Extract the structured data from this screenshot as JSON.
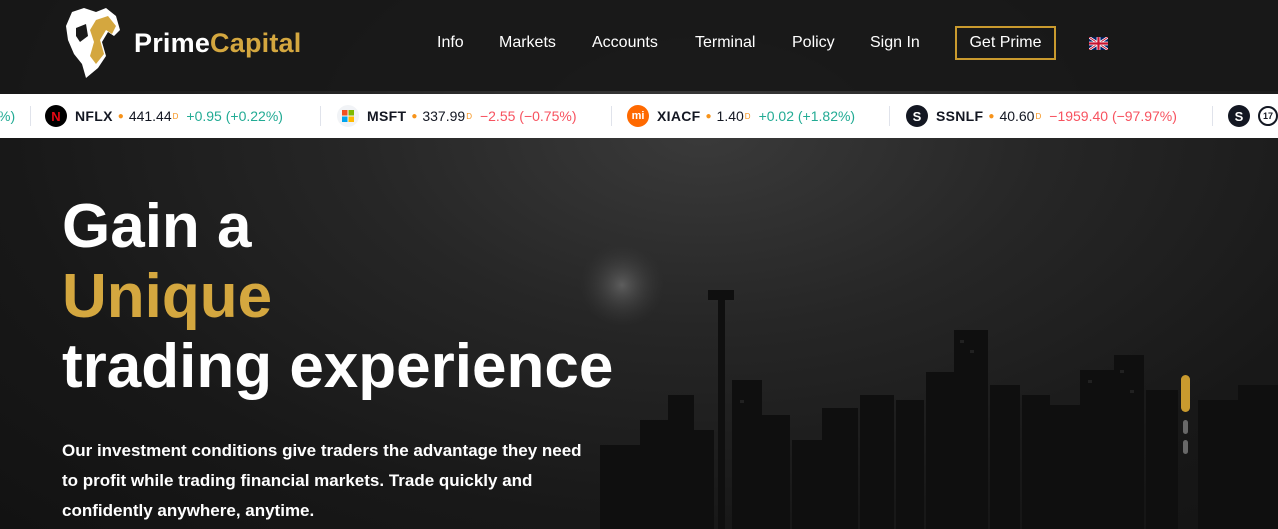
{
  "brand": {
    "name_first": "Prime",
    "name_second": "Capital",
    "accent": "#d4a73f"
  },
  "nav": {
    "items": [
      {
        "label": "Info"
      },
      {
        "label": "Markets"
      },
      {
        "label": "Accounts"
      },
      {
        "label": "Terminal"
      },
      {
        "label": "Policy"
      },
      {
        "label": "Sign In"
      }
    ],
    "cta_label": "Get Prime",
    "language_icon": "uk-flag-icon"
  },
  "ticker": {
    "leading_fragment": "%)",
    "items": [
      {
        "symbol": "NFLX",
        "price": "441.44",
        "flag": "D",
        "change": "+0.95 (+0.22%)",
        "direction": "up",
        "icon": "netflix-logo-icon"
      },
      {
        "symbol": "MSFT",
        "price": "337.99",
        "flag": "D",
        "change": "−2.55 (−0.75%)",
        "direction": "down",
        "icon": "microsoft-logo-icon"
      },
      {
        "symbol": "XIACF",
        "price": "1.40",
        "flag": "D",
        "change": "+0.02 (+1.82%)",
        "direction": "up",
        "icon": "xiaomi-logo-icon"
      },
      {
        "symbol": "SSNLF",
        "price": "40.60",
        "flag": "D",
        "change": "−1959.40 (−97.97%)",
        "direction": "down",
        "icon": "samsung-logo-icon"
      }
    ],
    "colors": {
      "up": "#22ab94",
      "down": "#f7525f"
    }
  },
  "hero": {
    "line1": "Gain a",
    "line2": "Unique",
    "line3": "trading experience",
    "description": "Our investment conditions give traders the advantage they need to profit while trading financial markets. Trade quickly and confidently anywhere, anytime."
  }
}
